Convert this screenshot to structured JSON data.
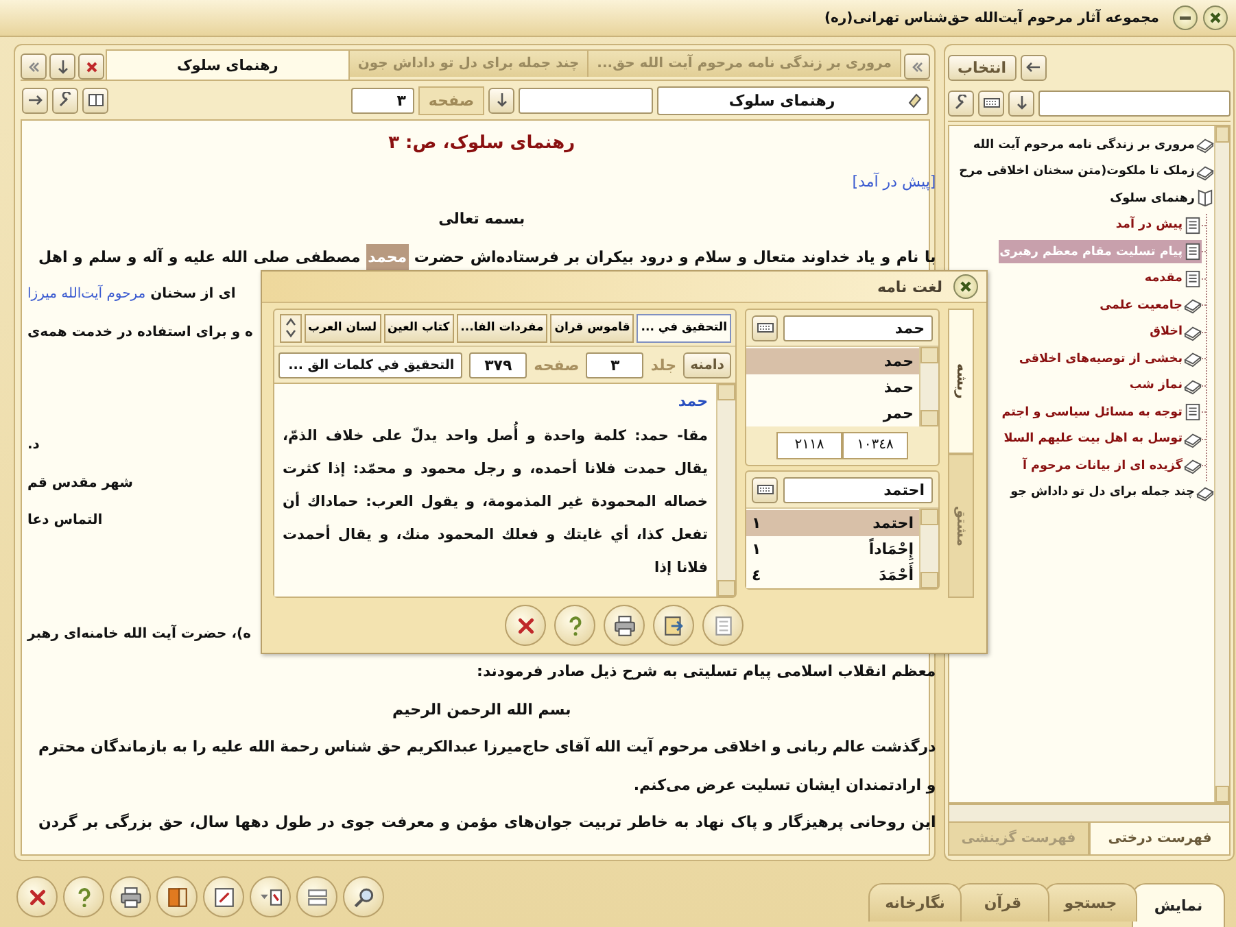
{
  "window": {
    "title": "مجموعه آثار مرحوم آیت‌الله حق‌شناس تهرانی(ره)"
  },
  "reader": {
    "tabs": [
      {
        "label": "مروری بر زندگی نامه مرحوم آیت الله حق...",
        "selected": false
      },
      {
        "label": "چند جمله برای دل تو داداش جون",
        "selected": false
      },
      {
        "label": "رهنمای سلوک",
        "selected": true
      }
    ],
    "book_field": {
      "value": "رهنمای سلوک"
    },
    "page_label": "صفحه",
    "page_field": {
      "value": "۳"
    },
    "rows": [
      {
        "kind": "heading",
        "parts": [
          {
            "kind": "text",
            "text": "رهنمای سلوک، ص: ۳"
          }
        ]
      },
      {
        "kind": "right",
        "parts": [
          {
            "kind": "link",
            "text": "[پیش در آمد]"
          }
        ]
      },
      {
        "kind": "center",
        "parts": [
          {
            "kind": "text",
            "text": "بسمه تعالی"
          }
        ]
      },
      {
        "kind": "justify",
        "parts": [
          {
            "kind": "text",
            "text": "با نام و یاد خداوند متعال و سلام و درود بیکران بر فرستاده‌اش حضرت "
          },
          {
            "kind": "highlight",
            "text": "محمد"
          },
          {
            "kind": "text",
            "text": " مصطفی صلی الله علیه و آله و سلم و اهل"
          }
        ]
      },
      {
        "kind": "left",
        "parts": [
          {
            "kind": "text",
            "text": "ای از سخنان "
          },
          {
            "kind": "link",
            "text": "مرحوم آیت‌الله میرزا"
          }
        ]
      },
      {
        "kind": "left",
        "parts": [
          {
            "kind": "text",
            "text": "ه و برای استفاده در خدمت همه‌ی"
          }
        ]
      },
      {
        "kind": "gap"
      },
      {
        "kind": "gap"
      },
      {
        "kind": "left",
        "parts": [
          {
            "kind": "text",
            "text": "د."
          }
        ]
      },
      {
        "kind": "left",
        "parts": [
          {
            "kind": "text",
            "text": "شهر مقدس قم"
          }
        ]
      },
      {
        "kind": "left",
        "parts": [
          {
            "kind": "text",
            "text": "التماس دعا"
          }
        ]
      },
      {
        "kind": "gap"
      },
      {
        "kind": "gap"
      },
      {
        "kind": "left",
        "parts": [
          {
            "kind": "text",
            "text": "ه)، حضرت آیت الله خامنه‌ای رهبر"
          }
        ]
      },
      {
        "kind": "right",
        "parts": [
          {
            "kind": "text",
            "text": "معظم انقلاب اسلامی پیام تسلیتی به شرح ذیل صادر فرمودند:"
          }
        ]
      },
      {
        "kind": "center",
        "parts": [
          {
            "kind": "text",
            "text": "بسم الله الرحمن الرحیم"
          }
        ]
      },
      {
        "kind": "justify",
        "parts": [
          {
            "kind": "text",
            "text": "درگذشت عالم ربانی و اخلاقی مرحوم آیت الله آقای حاج‌میرزا عبدالکریم حق شناس رحمة الله علیه را به بازماندگان محترم"
          }
        ]
      },
      {
        "kind": "right",
        "parts": [
          {
            "kind": "text",
            "text": "و ارادتمندان ایشان تسلیت عرض می‌کنم."
          }
        ]
      },
      {
        "kind": "justify",
        "parts": [
          {
            "kind": "text",
            "text": "این روحانی پرهیزگار و پاک نهاد به خاطر تربیت جوان‌های مؤمن و معرفت جوی در طول دهها سال، حق بزرگی بر گردن"
          }
        ]
      }
    ]
  },
  "index": {
    "select_button": "انتخاب",
    "tree": [
      {
        "label": "مروری بر زندگی نامه مرحوم آیت الله",
        "kind": "book",
        "selected": false
      },
      {
        "label": "زملک تا ملکوت(متن سخنان اخلاقی مرح",
        "kind": "book",
        "selected": false
      },
      {
        "label": "رهنمای سلوک",
        "kind": "open-book",
        "selected": false,
        "children": [
          {
            "label": "پیش در آمد",
            "kind": "page",
            "selected": false
          },
          {
            "label": "پیام تسلیت مقام معظم رهبری",
            "kind": "page",
            "selected": true
          },
          {
            "label": "مقدمه",
            "kind": "page",
            "selected": false
          },
          {
            "label": "جامعیت علمی",
            "kind": "book",
            "selected": false
          },
          {
            "label": "اخلاق",
            "kind": "book",
            "selected": false
          },
          {
            "label": "بخشی از توصیه‌های اخلاقی",
            "kind": "book",
            "selected": false
          },
          {
            "label": "نماز شب",
            "kind": "book",
            "selected": false
          },
          {
            "label": "توجه به مسائل سیاسی و اجتم",
            "kind": "page",
            "selected": false
          },
          {
            "label": "توسل به اهل بیت علیهم السلا",
            "kind": "book",
            "selected": false
          },
          {
            "label": "گزیده ای از بیانات مرحوم آ",
            "kind": "book",
            "selected": false
          }
        ]
      },
      {
        "label": "چند جمله برای دل تو داداش جو",
        "kind": "book",
        "selected": false
      }
    ],
    "tabs": [
      {
        "label": "فهرست درختی",
        "selected": true
      },
      {
        "label": "فهرست گزینشی",
        "selected": false
      }
    ]
  },
  "dictionary": {
    "title": "لغت نامه",
    "side_tabs": [
      {
        "label": "ریشه",
        "selected": true
      },
      {
        "label": "مشتق",
        "selected": false
      }
    ],
    "root_search": {
      "value": "حمد"
    },
    "roots": [
      {
        "word": "حمد",
        "selected": true
      },
      {
        "word": "حمذ",
        "selected": false
      },
      {
        "word": "حمر",
        "selected": false
      }
    ],
    "counts": [
      "١٠٣٤٨",
      "٢١١٨"
    ],
    "derived_search": {
      "value": "احتمد"
    },
    "derived": [
      {
        "word": "احتمد",
        "count": "١",
        "selected": true
      },
      {
        "word": "إِحْمَاداً",
        "count": "١",
        "selected": false
      },
      {
        "word": "أَحْمَدَ",
        "count": "٤",
        "selected": false
      }
    ],
    "sources": [
      {
        "label": "التحقيق في ...",
        "selected": true
      },
      {
        "label": "قاموس قران",
        "selected": false
      },
      {
        "label": "مفردات الفا...",
        "selected": false
      },
      {
        "label": "كتاب العين",
        "selected": false
      },
      {
        "label": "لسان العرب",
        "selected": false
      }
    ],
    "scope_button": "دامنه",
    "volume_label": "جلد",
    "volume": {
      "value": "٣"
    },
    "page_label": "صفحه",
    "page": {
      "value": "٣٧٩"
    },
    "source_field": {
      "value": "التحقيق في كلمات الق ..."
    },
    "entry_title": "حمد",
    "entry_text": "مقا- حمد: كلمة واحدة و أُصل واحد يدلّ على خلاف الذمّ، يقال حمدت فلانا أحمده، و رجل محمود و محمّد: إذا كثرت خصاله المحمودة غير المذمومة، و يقول العرب: حماداك أن تفعل كذا، أي غايتك و فعلك المحمود منك، و يقال أحمدت فلانا إذا"
  },
  "bottom_tabs": [
    {
      "label": "نمایش",
      "selected": true
    },
    {
      "label": "جستجو",
      "selected": false
    },
    {
      "label": "قرآن",
      "selected": false
    },
    {
      "label": "نگارخانه",
      "selected": false
    }
  ]
}
